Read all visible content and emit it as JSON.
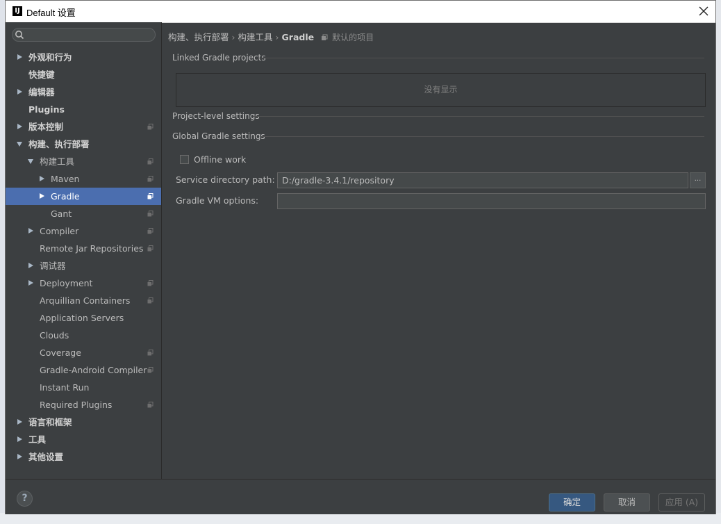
{
  "window": {
    "title": "Default 设置",
    "icon_text": "IJ"
  },
  "sidebar": {
    "search_placeholder": "",
    "items": [
      {
        "label": "外观和行为",
        "bold": true,
        "expander": "right",
        "level": 0
      },
      {
        "label": "快捷键",
        "bold": true,
        "expander": "none",
        "level": 0
      },
      {
        "label": "编辑器",
        "bold": true,
        "expander": "right",
        "level": 0
      },
      {
        "label": "Plugins",
        "bold": true,
        "expander": "none",
        "level": 0
      },
      {
        "label": "版本控制",
        "bold": true,
        "expander": "right",
        "level": 0,
        "copy": true
      },
      {
        "label": "构建、执行部署",
        "bold": true,
        "expander": "down",
        "level": 0
      },
      {
        "label": "构建工具",
        "bold": false,
        "expander": "down",
        "level": 1,
        "copy": true
      },
      {
        "label": "Maven",
        "bold": false,
        "expander": "right",
        "level": 2,
        "copy": true
      },
      {
        "label": "Gradle",
        "bold": false,
        "expander": "right",
        "level": 2,
        "copy": true,
        "selected": true
      },
      {
        "label": "Gant",
        "bold": false,
        "expander": "none",
        "level": 2,
        "copy": true
      },
      {
        "label": "Compiler",
        "bold": false,
        "expander": "right",
        "level": 1,
        "copy": true
      },
      {
        "label": "Remote Jar Repositories",
        "bold": false,
        "expander": "none",
        "level": 1,
        "copy": true
      },
      {
        "label": "调试器",
        "bold": false,
        "expander": "right",
        "level": 1
      },
      {
        "label": "Deployment",
        "bold": false,
        "expander": "right",
        "level": 1,
        "copy": true
      },
      {
        "label": "Arquillian Containers",
        "bold": false,
        "expander": "none",
        "level": 1,
        "copy": true
      },
      {
        "label": "Application Servers",
        "bold": false,
        "expander": "none",
        "level": 1
      },
      {
        "label": "Clouds",
        "bold": false,
        "expander": "none",
        "level": 1
      },
      {
        "label": "Coverage",
        "bold": false,
        "expander": "none",
        "level": 1,
        "copy": true
      },
      {
        "label": "Gradle-Android Compiler",
        "bold": false,
        "expander": "none",
        "level": 1,
        "copy": true
      },
      {
        "label": "Instant Run",
        "bold": false,
        "expander": "none",
        "level": 1
      },
      {
        "label": "Required Plugins",
        "bold": false,
        "expander": "none",
        "level": 1,
        "copy": true
      },
      {
        "label": "语言和框架",
        "bold": true,
        "expander": "right",
        "level": 0
      },
      {
        "label": "工具",
        "bold": true,
        "expander": "right",
        "level": 0
      },
      {
        "label": "其他设置",
        "bold": true,
        "expander": "right",
        "level": 0
      }
    ]
  },
  "breadcrumb": {
    "parts": [
      "构建、执行部署",
      "构建工具"
    ],
    "current": "Gradle",
    "sep": "›",
    "default_label": "默认的项目"
  },
  "sections": {
    "linked_projects": "Linked Gradle projects",
    "empty_text": "没有显示",
    "project_level": "Project-level settings",
    "global": "Global Gradle settings"
  },
  "form": {
    "offline_work_label": "Offline work",
    "offline_work_checked": false,
    "service_dir_label": "Service directory path:",
    "service_dir_value": "D:/gradle-3.4.1/repository",
    "browse_label": "...",
    "vm_options_label": "Gradle VM options:",
    "vm_options_value": ""
  },
  "buttons": {
    "help": "?",
    "ok": "确定",
    "cancel": "取消",
    "apply": "应用 (A)"
  },
  "colors": {
    "background": "#3c3f41",
    "selection": "#4b6eaf",
    "primary_button": "#365880"
  }
}
